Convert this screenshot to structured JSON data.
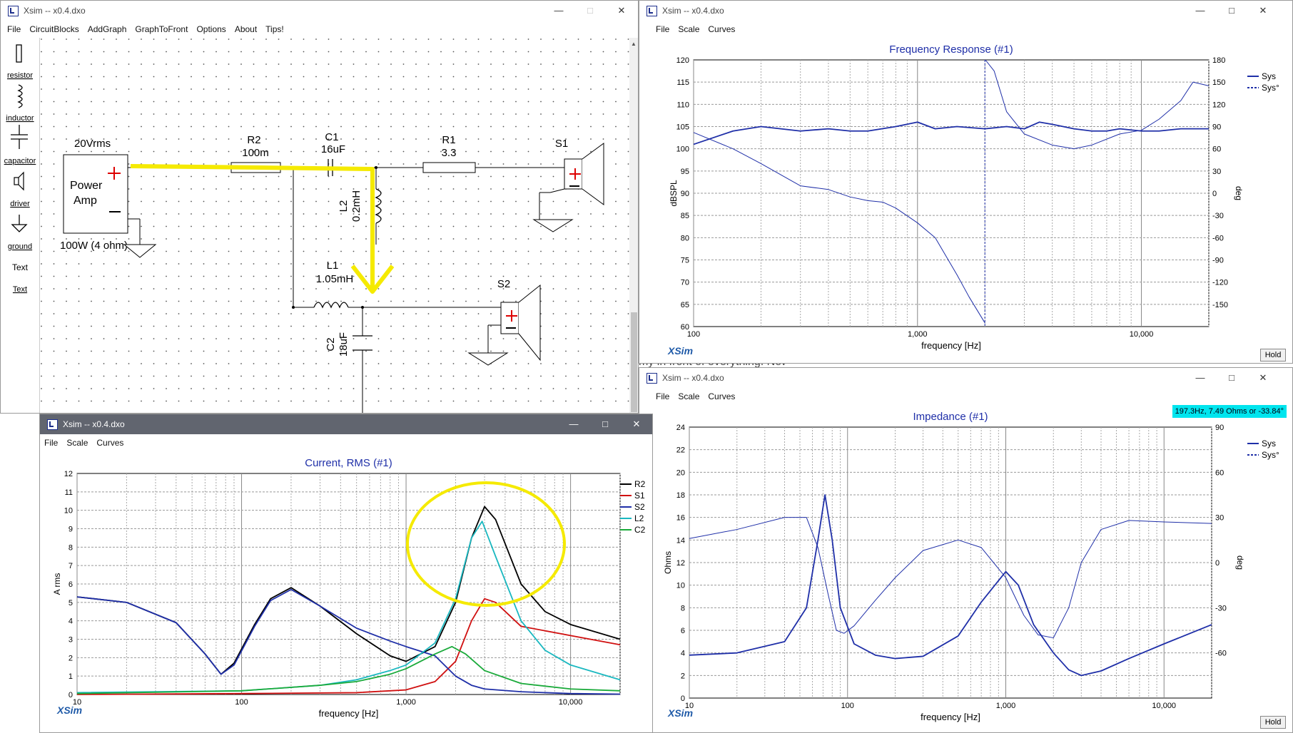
{
  "schematic": {
    "title": "Xsim -- x0.4.dxo",
    "menu": [
      "File",
      "CircuitBlocks",
      "AddGraph",
      "GraphToFront",
      "Options",
      "About",
      "Tips!"
    ],
    "palette": [
      {
        "icon": "resistor-icon",
        "label": "resistor"
      },
      {
        "icon": "inductor-icon",
        "label": "inductor"
      },
      {
        "icon": "capacitor-icon",
        "label": "capacitor"
      },
      {
        "icon": "driver-icon",
        "label": "driver"
      },
      {
        "icon": "ground-icon",
        "label": "ground"
      },
      {
        "icon": "text-icon",
        "label": "Text"
      },
      {
        "icon": "text-link-icon",
        "label": "Text"
      }
    ],
    "amp": {
      "voltage": "20Vrms",
      "name1": "Power",
      "name2": "Amp",
      "rating": "100W (4 ohm)"
    },
    "r2": {
      "name": "R2",
      "value": "100m"
    },
    "c1": {
      "name": "C1",
      "value": "16uF"
    },
    "r1": {
      "name": "R1",
      "value": "3.3"
    },
    "l2": {
      "name": "L2",
      "value": "0.2mH"
    },
    "l1": {
      "name": "L1",
      "value": "1.05mH"
    },
    "c2": {
      "name": "C2",
      "value": "18uF"
    },
    "s1": {
      "name": "S1"
    },
    "s2": {
      "name": "S2"
    }
  },
  "freq": {
    "title": "Xsim -- x0.4.dxo",
    "menu": [
      "File",
      "Scale",
      "Curves"
    ],
    "hold": "Hold",
    "brand": "XSim",
    "chart_data": {
      "type": "line",
      "title": "Frequency Response (#1)",
      "xlabel": "frequency [Hz]",
      "ylabel": "dBSPL",
      "y2label": "deg",
      "xscale": "log",
      "xlim": [
        100,
        20000
      ],
      "ylim": [
        60,
        120
      ],
      "y2lim": [
        -180,
        180
      ],
      "xticks": [
        "100",
        "1,000",
        "10,000"
      ],
      "yticks": [
        "60",
        "65",
        "70",
        "75",
        "80",
        "85",
        "90",
        "95",
        "100",
        "105",
        "110",
        "115",
        "120"
      ],
      "y2ticks": [
        "-150",
        "-120",
        "-90",
        "-60",
        "-30",
        "0",
        "30",
        "60",
        "90",
        "120",
        "150",
        "180"
      ],
      "legend": [
        "Sys",
        "Sys°"
      ],
      "legend_position": "top-right",
      "grid": true,
      "colors": {
        "sys": "#1f2fa8"
      },
      "series": [
        {
          "name": "Sys",
          "axis": "left",
          "x": [
            100,
            150,
            200,
            300,
            400,
            500,
            600,
            800,
            1000,
            1200,
            1500,
            2000,
            2500,
            3000,
            3500,
            4000,
            5000,
            6000,
            7000,
            8000,
            10000,
            12000,
            15000,
            20000
          ],
          "y": [
            101,
            104,
            105,
            104,
            104.5,
            104,
            104,
            105,
            106,
            104.5,
            105,
            104.5,
            105,
            104.5,
            106,
            105.5,
            104.5,
            104,
            104,
            104.5,
            104,
            104,
            104.5,
            104.5
          ]
        },
        {
          "name": "Sys°",
          "axis": "right",
          "x": [
            100,
            150,
            200,
            300,
            400,
            500,
            600,
            700,
            800,
            1000,
            1200,
            1500,
            1700,
            2000,
            2010,
            2200,
            2500,
            3000,
            4000,
            5000,
            6000,
            8000,
            10000,
            12000,
            15000,
            17000,
            20000
          ],
          "y": [
            82,
            60,
            40,
            10,
            5,
            -5,
            -10,
            -12,
            -20,
            -40,
            -60,
            -110,
            -140,
            -175,
            180,
            165,
            110,
            80,
            65,
            60,
            65,
            80,
            85,
            100,
            125,
            150,
            145
          ]
        }
      ]
    }
  },
  "current": {
    "title": "Xsim -- x0.4.dxo",
    "menu": [
      "File",
      "Scale",
      "Curves"
    ],
    "brand": "XSim",
    "chart_data": {
      "type": "line",
      "title": "Current, RMS (#1)",
      "xlabel": "frequency [Hz]",
      "ylabel": "A rms",
      "xscale": "log",
      "xlim": [
        10,
        20000
      ],
      "ylim": [
        0,
        12
      ],
      "xticks": [
        "10",
        "100",
        "1,000",
        "10,000"
      ],
      "yticks": [
        "0",
        "1",
        "2",
        "3",
        "4",
        "5",
        "6",
        "7",
        "8",
        "9",
        "10",
        "11",
        "12"
      ],
      "legend": [
        "R2",
        "S1",
        "S2",
        "L2",
        "C2"
      ],
      "legend_position": "top-right",
      "grid": true,
      "colors": {
        "R2": "#000000",
        "S1": "#d01010",
        "S2": "#1f2fa8",
        "L2": "#1ab8c0",
        "C2": "#1aaa3a"
      },
      "series": [
        {
          "name": "R2",
          "x": [
            10,
            20,
            40,
            60,
            75,
            90,
            120,
            150,
            200,
            300,
            500,
            800,
            1000,
            1500,
            2000,
            2500,
            3000,
            3500,
            5000,
            7000,
            10000,
            20000
          ],
          "y": [
            5.3,
            5.0,
            3.9,
            2.2,
            1.1,
            1.7,
            3.8,
            5.2,
            5.8,
            4.8,
            3.3,
            2.1,
            1.8,
            2.6,
            5.0,
            8.5,
            10.2,
            9.5,
            6.0,
            4.5,
            3.8,
            3.0
          ]
        },
        {
          "name": "S1",
          "x": [
            10,
            100,
            500,
            1000,
            1500,
            2000,
            2500,
            3000,
            3500,
            5000,
            10000,
            20000
          ],
          "y": [
            0,
            0.05,
            0.1,
            0.25,
            0.7,
            1.8,
            4.0,
            5.2,
            5.0,
            3.7,
            3.2,
            2.7
          ]
        },
        {
          "name": "S2",
          "x": [
            10,
            20,
            40,
            60,
            75,
            90,
            120,
            150,
            200,
            300,
            500,
            800,
            1000,
            1500,
            2000,
            2500,
            3000,
            5000,
            10000,
            20000
          ],
          "y": [
            5.3,
            5.0,
            3.9,
            2.2,
            1.1,
            1.6,
            3.7,
            5.1,
            5.7,
            4.8,
            3.6,
            2.9,
            2.6,
            2.1,
            1.0,
            0.5,
            0.3,
            0.15,
            0.05,
            0.02
          ]
        },
        {
          "name": "L2",
          "x": [
            10,
            100,
            300,
            500,
            800,
            1000,
            1500,
            2000,
            2500,
            2900,
            3500,
            5000,
            7000,
            10000,
            20000
          ],
          "y": [
            0.1,
            0.2,
            0.5,
            0.8,
            1.3,
            1.6,
            2.8,
            5.2,
            8.5,
            9.4,
            7.5,
            4.0,
            2.4,
            1.6,
            0.8
          ]
        },
        {
          "name": "C2",
          "x": [
            10,
            100,
            300,
            500,
            800,
            1000,
            1500,
            1900,
            2300,
            3000,
            5000,
            10000,
            20000
          ],
          "y": [
            0.05,
            0.2,
            0.5,
            0.7,
            1.1,
            1.4,
            2.2,
            2.6,
            2.2,
            1.3,
            0.6,
            0.3,
            0.2
          ]
        }
      ]
    }
  },
  "impedance": {
    "title": "Xsim -- x0.4.dxo",
    "menu": [
      "File",
      "Scale",
      "Curves"
    ],
    "hold": "Hold",
    "brand": "XSim",
    "readout": "197.3Hz, 7.49 Ohms or -33.84°",
    "chart_data": {
      "type": "line",
      "title": "Impedance (#1)",
      "xlabel": "frequency [Hz]",
      "ylabel": "Ohms",
      "y2label": "deg",
      "xscale": "log",
      "xlim": [
        10,
        20000
      ],
      "ylim": [
        0,
        24
      ],
      "y2lim": [
        -90,
        90
      ],
      "xticks": [
        "10",
        "100",
        "1,000",
        "10,000"
      ],
      "yticks": [
        "0",
        "2",
        "4",
        "6",
        "8",
        "10",
        "12",
        "14",
        "16",
        "18",
        "20",
        "22",
        "24"
      ],
      "y2ticks": [
        "-60",
        "-30",
        "0",
        "30",
        "60",
        "90"
      ],
      "legend": [
        "Sys",
        "Sys°"
      ],
      "legend_position": "top-right",
      "grid": true,
      "colors": {
        "sys": "#1f2fa8"
      },
      "series": [
        {
          "name": "Sys",
          "axis": "left",
          "x": [
            10,
            20,
            40,
            55,
            65,
            72,
            80,
            90,
            110,
            150,
            200,
            300,
            500,
            700,
            1000,
            1200,
            1500,
            2000,
            2500,
            3000,
            4000,
            6000,
            10000,
            20000
          ],
          "y": [
            3.8,
            4.0,
            5.0,
            8.0,
            14.0,
            18.0,
            14.0,
            8.0,
            4.8,
            3.8,
            3.5,
            3.7,
            5.5,
            8.5,
            11.2,
            10.0,
            6.5,
            4.0,
            2.5,
            2.0,
            2.4,
            3.5,
            4.8,
            6.5
          ]
        },
        {
          "name": "Sys°",
          "axis": "right",
          "x": [
            10,
            20,
            40,
            55,
            65,
            75,
            85,
            95,
            110,
            150,
            200,
            300,
            500,
            700,
            1000,
            1300,
            1600,
            2000,
            2500,
            3000,
            4000,
            6000,
            10000,
            20000
          ],
          "y": [
            16,
            22,
            30,
            30,
            10,
            -20,
            -45,
            -47,
            -42,
            -25,
            -10,
            8,
            15,
            10,
            -10,
            -35,
            -48,
            -50,
            -30,
            0,
            22,
            28,
            27,
            26
          ]
        }
      ]
    }
  }
}
